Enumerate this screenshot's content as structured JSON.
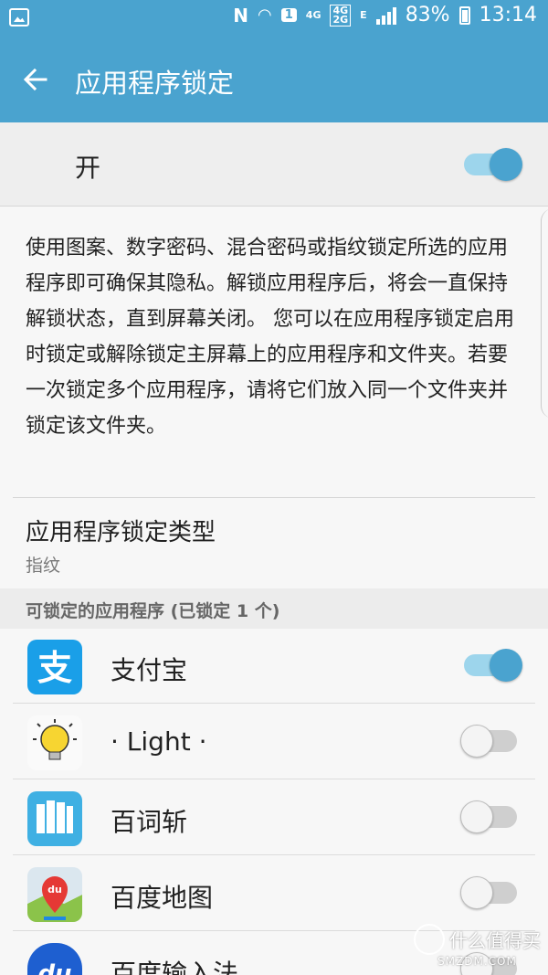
{
  "status_bar": {
    "network_small": "4G",
    "network_dual_top": "4G",
    "network_dual_bottom": "2G",
    "sim_badge": "1",
    "data_indicator": "E",
    "battery": "83%",
    "time": "13:14",
    "icons": [
      "image-icon",
      "nfc-icon",
      "wifi-icon",
      "signal-icon",
      "battery-icon"
    ]
  },
  "app_bar": {
    "back_icon": "arrow-left-icon",
    "title": "应用程序锁定"
  },
  "master_switch": {
    "label": "开",
    "state": "on"
  },
  "description": "使用图案、数字密码、混合密码或指纹锁定所选的应用程序即可确保其隐私。解锁应用程序后，将会一直保持解锁状态，直到屏幕关闭。 您可以在应用程序锁定启用时锁定或解除锁定主屏幕上的应用程序和文件夹。若要一次锁定多个应用程序，请将它们放入同一个文件夹并锁定该文件夹。",
  "lock_type": {
    "title": "应用程序锁定类型",
    "value": "指纹"
  },
  "section_header": "可锁定的应用程序 (已锁定 1 个)",
  "apps": [
    {
      "name": "支付宝",
      "icon": "alipay-icon",
      "locked": true
    },
    {
      "name": "· Light ·",
      "icon": "light-bulb-icon",
      "locked": false
    },
    {
      "name": "百词斩",
      "icon": "baicizhan-icon",
      "locked": false
    },
    {
      "name": "百度地图",
      "icon": "baidu-map-icon",
      "locked": false
    },
    {
      "name": "百度输入法",
      "icon": "baidu-input-icon",
      "locked": false
    }
  ],
  "watermark": {
    "main": "什么值得买",
    "sub": "SMZDM.COM"
  },
  "colors": {
    "accent": "#4aa3cf",
    "toggle_track_on": "#9dd5ec"
  }
}
